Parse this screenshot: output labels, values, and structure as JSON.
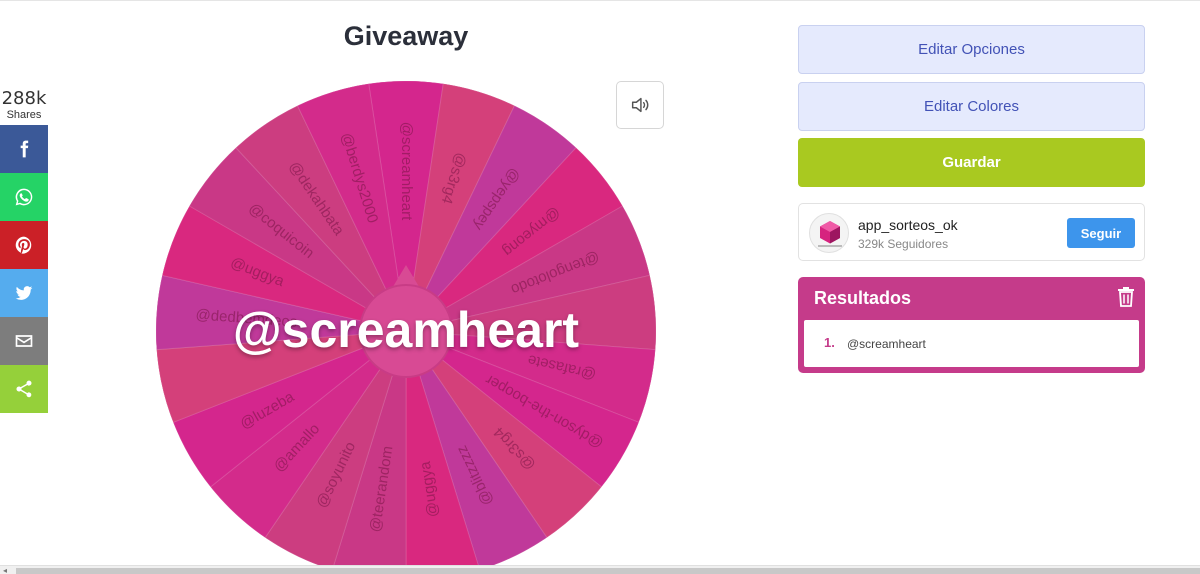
{
  "share": {
    "count": "288k",
    "label": "Shares",
    "buttons": [
      {
        "name": "facebook",
        "icon": "facebook-icon",
        "color": "#3b5998"
      },
      {
        "name": "whatsapp",
        "icon": "whatsapp-icon",
        "color": "#25d366"
      },
      {
        "name": "pinterest",
        "icon": "pinterest-icon",
        "color": "#cb2027"
      },
      {
        "name": "twitter",
        "icon": "twitter-icon",
        "color": "#55acee"
      },
      {
        "name": "email",
        "icon": "email-icon",
        "color": "#7d7d7d"
      },
      {
        "name": "sharethis",
        "icon": "share-icon",
        "color": "#95d03a"
      }
    ]
  },
  "wheel": {
    "title": "Giveaway",
    "winner": "@screamheart",
    "sound_icon": "speaker-icon",
    "segments": [
      "@screamheart",
      "@s3rg4",
      "@yepspey",
      "@myeong",
      "@tengolotodo",
      "",
      "@rafasete",
      "@dyson-the-booper",
      "@s3rg4",
      "@blitzzzz",
      "@uggya",
      "@teerandom",
      "@soyunito",
      "@amallo",
      "@luzeba",
      "",
      "@dedbemdeos",
      "@uggya",
      "@coquicoin",
      "@dekahbata",
      "@berdys2000"
    ],
    "colors": [
      "#d4268d",
      "#d4407a",
      "#c0399a",
      "#d9287f",
      "#c93886",
      "#cc3d80",
      "#d32b8b"
    ]
  },
  "panel": {
    "edit_options": "Editar Opciones",
    "edit_colors": "Editar Colores",
    "save": "Guardar",
    "profile": {
      "name": "app_sorteos_ok",
      "followers": "329k Seguidores",
      "follow": "Seguir"
    },
    "results": {
      "title": "Resultados",
      "trash_icon": "trash-icon",
      "items": [
        {
          "num": "1.",
          "name": "@screamheart"
        }
      ]
    }
  }
}
